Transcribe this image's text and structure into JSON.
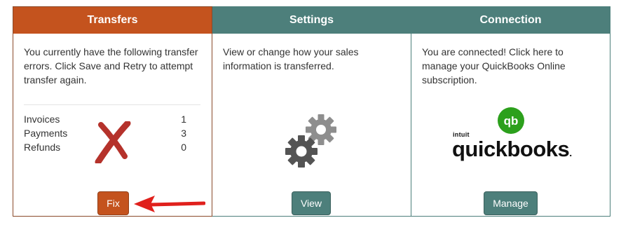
{
  "colors": {
    "transfers": "#c4531e",
    "teal": "#4d7f7b",
    "error_x": "#b5322b",
    "arrow": "#e0201c",
    "qb_green": "#2ca01c"
  },
  "transfers": {
    "title": "Transfers",
    "description": "You currently have the following transfer errors. Click Save and Retry to attempt transfer again.",
    "errors": [
      {
        "label": "Invoices",
        "value": "1"
      },
      {
        "label": "Payments",
        "value": "3"
      },
      {
        "label": "Refunds",
        "value": "0"
      }
    ],
    "icon": "x-mark-icon",
    "button_label": "Fix"
  },
  "settings": {
    "title": "Settings",
    "description": "View or change how your sales information is transferred.",
    "icon": "gears-icon",
    "button_label": "View"
  },
  "connection": {
    "title": "Connection",
    "description": "You are connected! Click here to manage your QuickBooks Online subscription.",
    "logo": {
      "icon_text": "qb",
      "brand_small": "intuit",
      "brand": "quickbooks",
      "brand_mark": "."
    },
    "button_label": "Manage"
  }
}
